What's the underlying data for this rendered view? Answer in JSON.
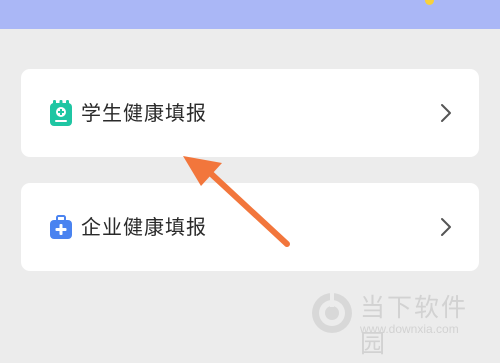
{
  "header": {
    "banner_color": "#aab7f6"
  },
  "menu": {
    "items": [
      {
        "label": "学生健康填报",
        "icon": "clipboard-plus-icon",
        "icon_color": "#1fc6a3"
      },
      {
        "label": "企业健康填报",
        "icon": "medical-kit-icon",
        "icon_color": "#4a83f0"
      }
    ]
  },
  "annotation": {
    "arrow_color": "#f2763c"
  },
  "watermark": {
    "title": "当下软件园",
    "url": "www.downxia.com"
  }
}
